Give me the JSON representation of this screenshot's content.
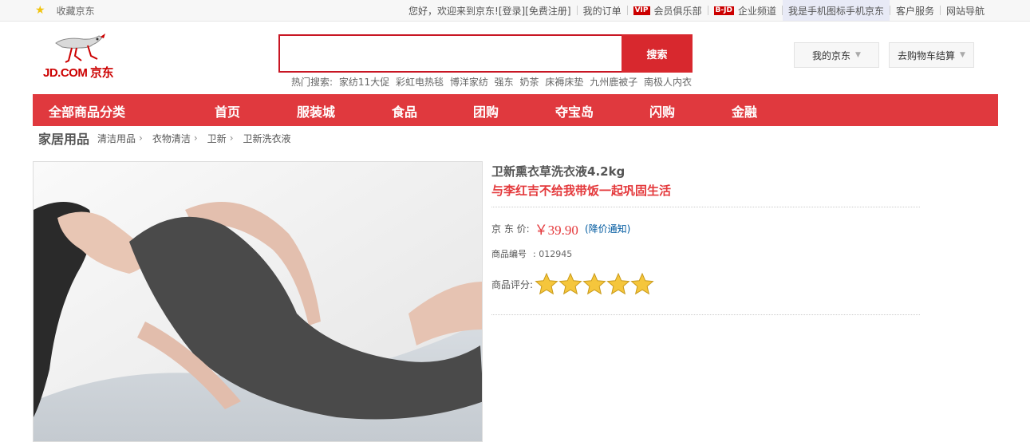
{
  "topbar": {
    "favorite": "收藏京东",
    "welcome": "您好，欢迎来到京东!",
    "login": "[登录]",
    "register": "[免费注册]",
    "orders": "我的订单",
    "vip_badge": "VIP",
    "vip": "会员俱乐部",
    "bjd_badge": "B-JD",
    "enterprise": "企业频道",
    "mobile": "我是手机图标手机京东",
    "service": "客户服务",
    "sitenav": "网站导航"
  },
  "logo": {
    "text": "JD.COM 京东"
  },
  "search": {
    "value": "",
    "button": "搜索",
    "hot_label": "热门搜索:",
    "hot_keywords": [
      "家纺11大促",
      "彩虹电热毯",
      "博洋家纺",
      "强东",
      "奶茶",
      "床褥床垫",
      "九州鹿被子",
      "南极人内衣"
    ]
  },
  "header": {
    "my_jd": "我的京东",
    "cart": "去购物车结算"
  },
  "nav": {
    "all": "全部商品分类",
    "items": [
      "首页",
      "服装城",
      "食品",
      "团购",
      "夺宝岛",
      "闪购",
      "金融"
    ]
  },
  "breadcrumb": {
    "category": "家居用品",
    "items": [
      "清洁用品",
      "衣物清洁",
      "卫新",
      "卫新洗衣液"
    ]
  },
  "product": {
    "title": "卫新熏衣草洗衣液4.2kg",
    "subtitle": "与李红吉不给我带饭一起巩固生活",
    "price_label": "京 东 价:",
    "price": "￥39.90",
    "price_notify": "(降价通知)",
    "code_label": "商品编号",
    "code_value": ": 012945",
    "rating_label": "商品评分:",
    "rating": 5
  },
  "colors": {
    "brand_red": "#e0393e",
    "price_red": "#e4393c",
    "link_blue": "#005aa0"
  }
}
